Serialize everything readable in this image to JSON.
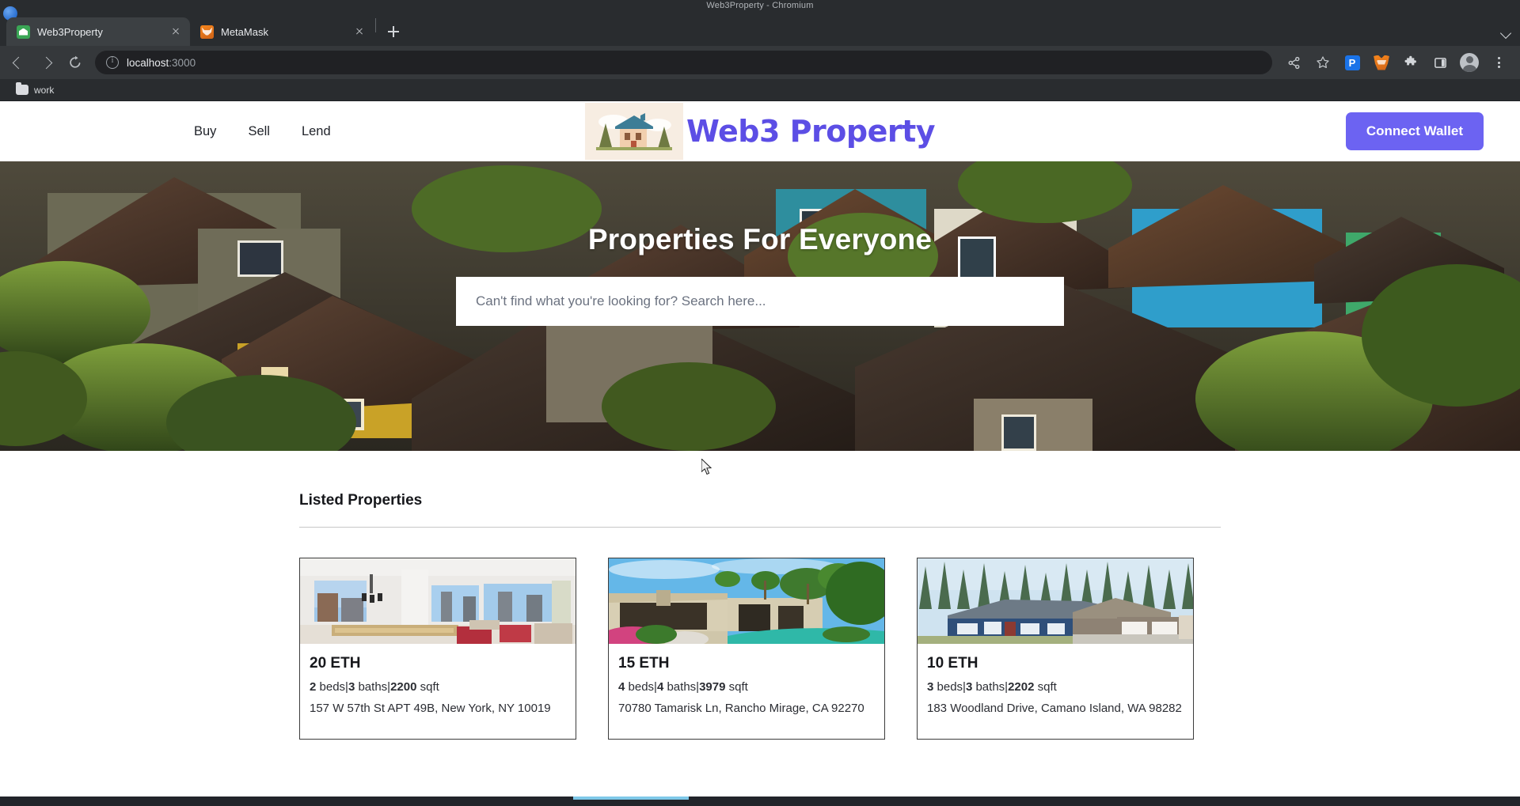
{
  "window": {
    "title": "Web3Property - Chromium"
  },
  "browser": {
    "tabs": [
      {
        "title": "Web3Property",
        "favicon": "house-green-icon",
        "active": true
      },
      {
        "title": "MetaMask",
        "favicon": "metamask-fox-icon",
        "active": false
      }
    ],
    "newtab_label": "+",
    "toolbar": {
      "back": "back-arrow",
      "forward": "forward-arrow",
      "reload": "reload",
      "site_info": "info-icon",
      "url_host": "localhost",
      "url_port": ":3000",
      "url_full": "localhost:3000",
      "icons": [
        "share-icon",
        "bookmark-star-icon",
        "extension-p-icon",
        "metamask-fox-icon",
        "puzzle-extensions-icon",
        "side-panel-icon",
        "profile-avatar-icon",
        "three-dot-menu-icon"
      ]
    },
    "bookmarks": [
      {
        "label": "work",
        "icon": "folder-icon"
      }
    ]
  },
  "page": {
    "nav": [
      {
        "label": "Buy"
      },
      {
        "label": "Sell"
      },
      {
        "label": "Lend"
      }
    ],
    "brand": {
      "name": "Web3 Property",
      "logo_alt": "house-logo",
      "color": "#5c4ee5"
    },
    "connect_wallet": {
      "label": "Connect Wallet",
      "color": "#6c63f2"
    },
    "hero": {
      "title": "Properties For Everyone",
      "search_placeholder": "Can't find what you're looking for? Search here...",
      "search_value": ""
    },
    "listings": {
      "title": "Listed Properties",
      "cards": [
        {
          "price": "20 ETH",
          "beds": "2",
          "beds_label": "beds",
          "baths": "3",
          "baths_label": "baths",
          "sqft": "2200",
          "sqft_label": "sqft",
          "address": "157 W 57th St APT 49B, New York, NY 10019",
          "image_alt": "modern-apartment-interior-city-view"
        },
        {
          "price": "15 ETH",
          "beds": "4",
          "beds_label": "beds",
          "baths": "4",
          "baths_label": "baths",
          "sqft": "3979",
          "sqft_label": "sqft",
          "address": "70780 Tamarisk Ln, Rancho Mirage, CA 92270",
          "image_alt": "desert-villa-with-pool-and-palms"
        },
        {
          "price": "10 ETH",
          "beds": "3",
          "beds_label": "beds",
          "baths": "3",
          "baths_label": "baths",
          "sqft": "2202",
          "sqft_label": "sqft",
          "address": "183 Woodland Drive, Camano Island, WA 98282",
          "image_alt": "blue-ranch-house-with-pine-trees"
        }
      ]
    }
  }
}
